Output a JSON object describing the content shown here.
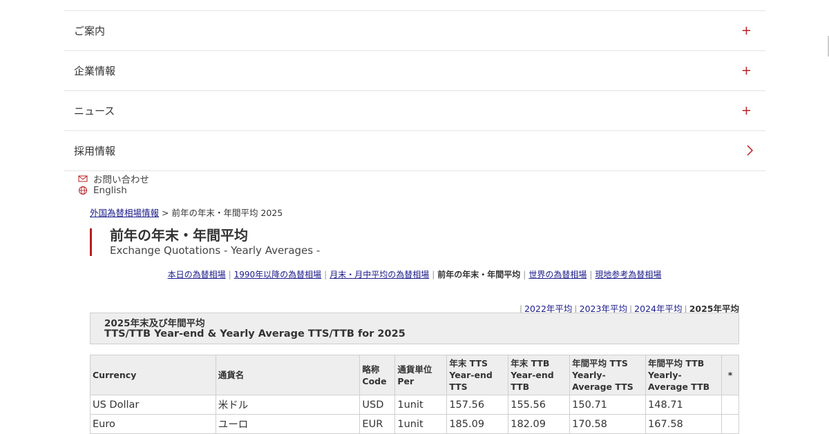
{
  "accordion": {
    "items": [
      {
        "label": "ご案内",
        "icon": "plus-icon"
      },
      {
        "label": "企業情報",
        "icon": "plus-icon"
      },
      {
        "label": "ニュース",
        "icon": "plus-icon"
      },
      {
        "label": "採用情報",
        "icon": "chevron-right-icon"
      }
    ]
  },
  "utility_links": {
    "contact": "お問い合わせ",
    "english": "English"
  },
  "breadcrumb": {
    "parent": "外国為替相場情報",
    "separator": " > ",
    "current": "前年の年末・年間平均 2025"
  },
  "page_title": {
    "jp": "前年の年末・年間平均",
    "en": "Exchange Quotations - Yearly Averages -"
  },
  "subnav": {
    "items": [
      {
        "label": "本日の為替相場",
        "link": true
      },
      {
        "label": "1990年以降の為替相場",
        "link": true
      },
      {
        "label": "月末・月中平均の為替相場",
        "link": true
      },
      {
        "label": "前年の年末・年間平均",
        "link": false
      },
      {
        "label": "世界の為替相場",
        "link": true
      },
      {
        "label": "現地参考為替相場",
        "link": true
      }
    ]
  },
  "year_nav": {
    "items": [
      {
        "label": "2022年平均",
        "link": true
      },
      {
        "label": "2023年平均",
        "link": true
      },
      {
        "label": "2024年平均",
        "link": true
      },
      {
        "label": "2025年平均",
        "link": false
      }
    ]
  },
  "caption": {
    "line1": "2025年末及び年間平均",
    "line2": "TTS/TTB Year-end & Yearly Average TTS/TTB for 2025"
  },
  "table": {
    "headers": [
      [
        "Currency"
      ],
      [
        "通貨名"
      ],
      [
        "略称",
        "Code"
      ],
      [
        "通貨単位",
        "Per"
      ],
      [
        "年末 TTS",
        "Year-end",
        "TTS"
      ],
      [
        "年末 TTB",
        "Year-end",
        "TTB"
      ],
      [
        "年間平均 TTS",
        "Yearly-",
        "Average TTS"
      ],
      [
        "年間平均 TTB",
        "Yearly-",
        "Average TTB"
      ],
      [
        "*"
      ]
    ],
    "rows": [
      [
        "US Dollar",
        "米ドル",
        "USD",
        "1unit",
        "157.56",
        "155.56",
        "150.71",
        "148.71",
        ""
      ],
      [
        "Euro",
        "ユーロ",
        "EUR",
        "1unit",
        "185.09",
        "182.09",
        "170.58",
        "167.58",
        ""
      ]
    ]
  },
  "colors": {
    "accent": "#b81c22",
    "link": "#1a1a8a",
    "header_bg": "#eeeeee"
  }
}
